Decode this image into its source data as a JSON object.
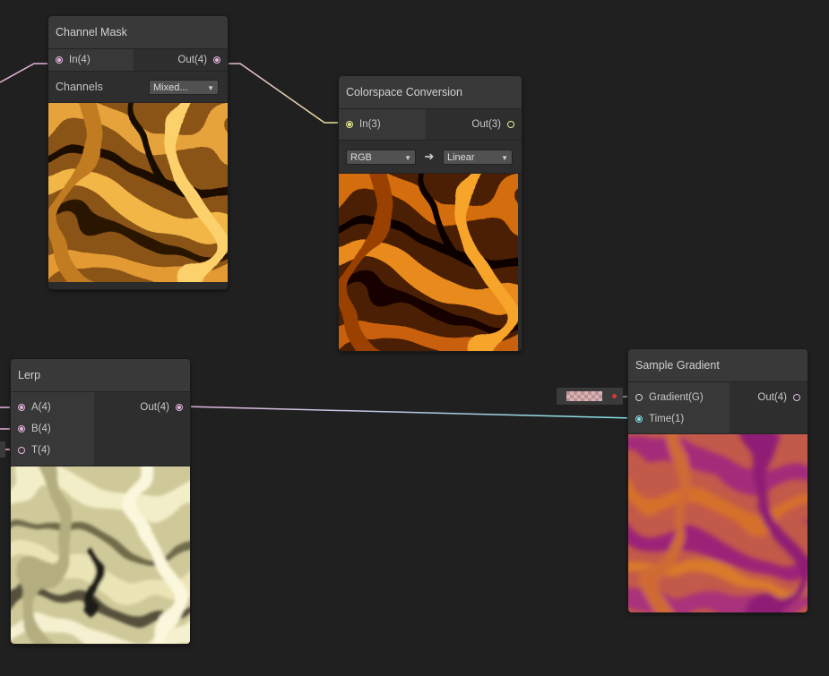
{
  "colors": {
    "background": "#202020",
    "vector4_port": "#e7b6de",
    "vector3_port": "#e9ea8e",
    "vector1_port": "#86e2ea",
    "gradient_port": "#d6d6d6"
  },
  "nodes": {
    "channel_mask": {
      "title": "Channel Mask",
      "input": "In(4)",
      "output": "Out(4)",
      "channels_label": "Channels",
      "channels_value": "Mixed..."
    },
    "colorspace": {
      "title": "Colorspace Conversion",
      "input": "In(3)",
      "output": "Out(3)",
      "from_value": "RGB",
      "arrow": "➔",
      "to_value": "Linear"
    },
    "lerp": {
      "title": "Lerp",
      "inputs": [
        "A(4)",
        "B(4)",
        "T(4)"
      ],
      "output": "Out(4)"
    },
    "sample_gradient": {
      "title": "Sample Gradient",
      "inputs": [
        "Gradient(G)",
        "Time(1)"
      ],
      "output": "Out(4)"
    }
  }
}
